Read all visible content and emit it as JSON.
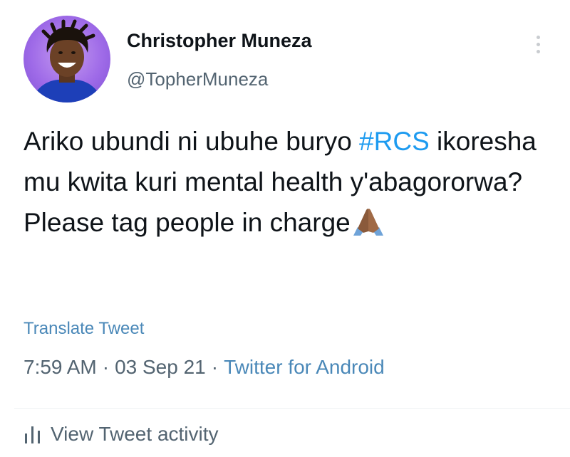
{
  "author": {
    "display_name": "Christopher Muneza",
    "handle": "@TopherMuneza"
  },
  "tweet": {
    "text_part1": "Ariko ubundi ni ubuhe buryo ",
    "hashtag": "#RCS",
    "text_part2": " ikoresha mu kwita kuri mental health y'abagororwa? Please tag people in charge",
    "emoji_icon": "folded-hands-icon"
  },
  "translate_label": "Translate Tweet",
  "meta": {
    "time": "7:59 AM",
    "separator": "·",
    "date": "03 Sep 21",
    "source": "Twitter for Android"
  },
  "activity_label": "View Tweet activity",
  "colors": {
    "link": "#1d9bf0",
    "muted": "#536471",
    "text": "#0f1419"
  }
}
